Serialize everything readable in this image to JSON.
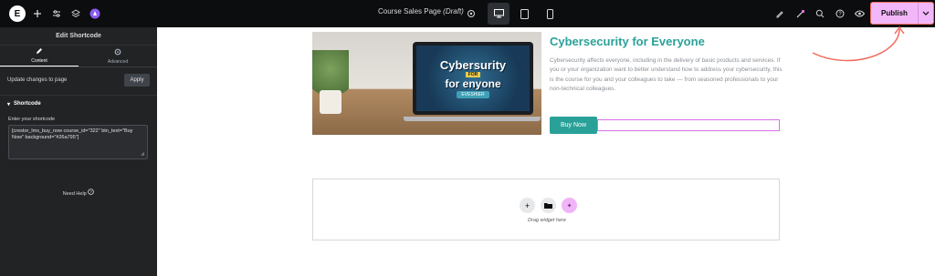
{
  "topbar": {
    "page_title": "Course Sales Page",
    "page_status": "(Draft)",
    "publish_label": "Publish",
    "icons": [
      "elementor-logo-icon",
      "plus-icon",
      "sliders-icon",
      "layers-icon",
      "ai-icon",
      "gear-icon",
      "desktop-icon",
      "tablet-icon",
      "mobile-icon",
      "marker-icon",
      "notifications-icon",
      "search-icon",
      "help-icon",
      "preview-icon",
      "chevron-down-icon"
    ]
  },
  "panel": {
    "title": "Edit Shortcode",
    "tabs": [
      {
        "label": "Content",
        "icon": "pencil-icon",
        "active": true
      },
      {
        "label": "Advanced",
        "icon": "gear-icon",
        "active": false
      }
    ],
    "apply_text": "Update changes to page",
    "apply_button": "Apply",
    "section_title": "Shortcode",
    "field_label": "Enter your shortcode",
    "shortcode_value": "[crestor_lms_buy_now course_id=\"322\" btn_text=\"Buy Now\" background=\"#26a795\"]",
    "need_help": "Need Help"
  },
  "content": {
    "heading": "Cybersecurity for Everyone",
    "description": "Cybersecurity affects everyone, including in the delivery of basic products and services. If you or your organization want to better understand how to address your cybersecurity, this is the course for you and your colleagues to take — from seasoned professionals to your non-technical colleagues.",
    "buy_button": "Buy Now",
    "image_text": {
      "line1": "Cybersurity",
      "line2": "FOR",
      "line3": "for enyone",
      "line4": "EVESHIER"
    },
    "dropzone_text": "Drag widget here"
  },
  "colors": {
    "accent_teal": "#2aa198",
    "publish_pink": "#f2b7f8",
    "annotation_red": "#f16b5f",
    "panel_bg": "#222325",
    "topbar_bg": "#0c0d0e"
  }
}
